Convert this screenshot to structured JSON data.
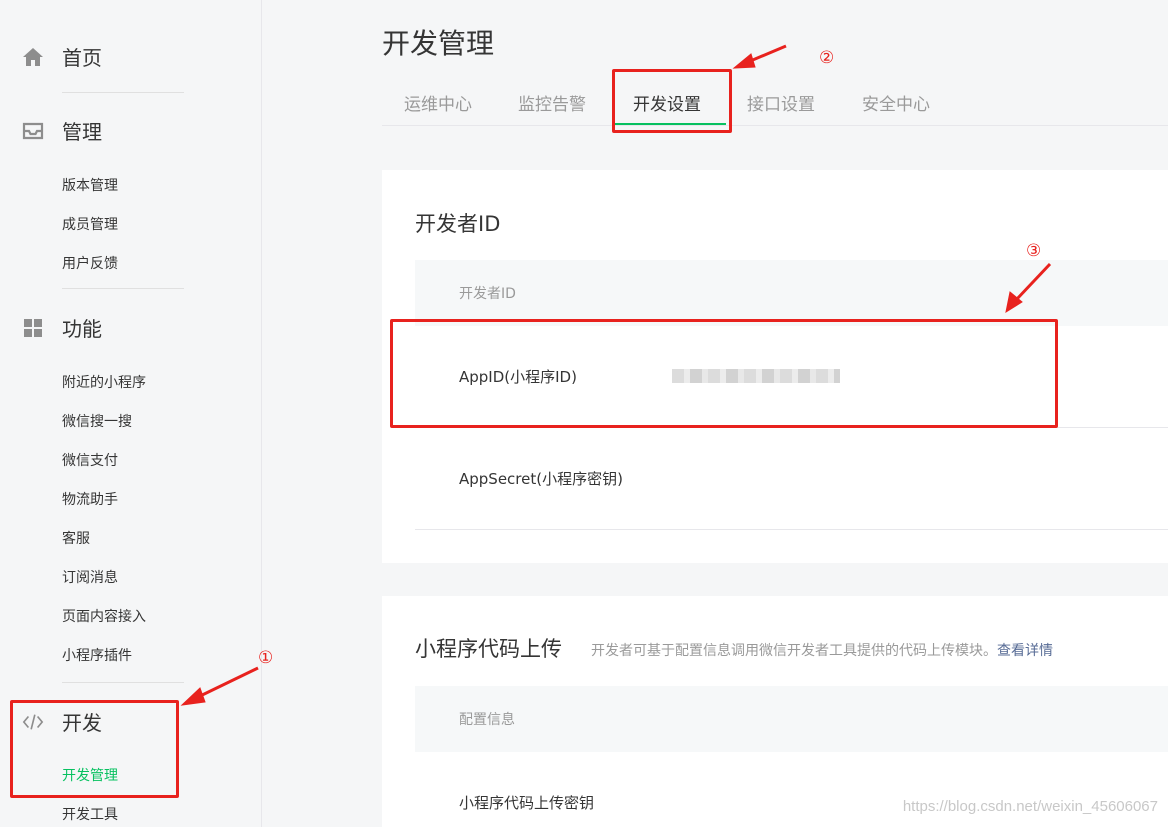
{
  "sidebar": {
    "home": {
      "label": "首页",
      "icon": "home-icon"
    },
    "manage": {
      "label": "管理",
      "icon": "inbox-icon",
      "items": [
        "版本管理",
        "成员管理",
        "用户反馈"
      ]
    },
    "features": {
      "label": "功能",
      "icon": "grid-icon",
      "items": [
        "附近的小程序",
        "微信搜一搜",
        "微信支付",
        "物流助手",
        "客服",
        "订阅消息",
        "页面内容接入",
        "小程序插件"
      ]
    },
    "dev": {
      "label": "开发",
      "icon": "code-icon",
      "items": [
        "开发管理",
        "开发工具"
      ],
      "active_item": "开发管理"
    }
  },
  "main": {
    "title": "开发管理",
    "tabs": [
      "运维中心",
      "监控告警",
      "开发设置",
      "接口设置",
      "安全中心"
    ],
    "active_tab": "开发设置",
    "developer_id_card": {
      "title": "开发者ID",
      "header": "开发者ID",
      "rows": [
        "AppID(小程序ID)",
        "AppSecret(小程序密钥)"
      ]
    },
    "upload_card": {
      "title": "小程序代码上传",
      "subtitle": "开发者可基于配置信息调用微信开发者工具提供的代码上传模块。",
      "link": "查看详情",
      "header": "配置信息",
      "rows": [
        "小程序代码上传密钥"
      ]
    }
  },
  "annotations": {
    "step1": "①",
    "step2": "②",
    "step3": "③",
    "color": "#e8221e"
  },
  "watermark": "https://blog.csdn.net/weixin_45606067",
  "colors": {
    "accent": "#07c160",
    "link": "#576b95"
  }
}
